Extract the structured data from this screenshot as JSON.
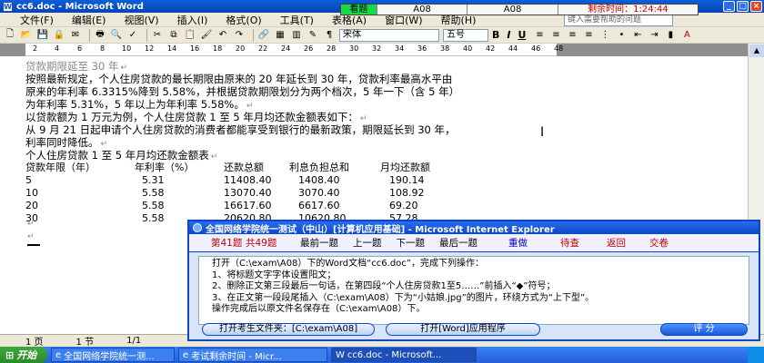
{
  "window": {
    "title": "cc6.doc - Microsoft Word"
  },
  "menu": {
    "items": [
      "文件(F)",
      "编辑(E)",
      "视图(V)",
      "插入(I)",
      "格式(O)",
      "工具(T)",
      "表格(A)",
      "窗口(W)",
      "帮助(H)"
    ],
    "help_placeholder": "键入需要帮助的问题"
  },
  "exam_bar": {
    "view_label": "看题",
    "exam_id_1": "A08",
    "exam_id_2": "A08",
    "time_left": "剩余时间：1:24:44"
  },
  "toolbar": {
    "font_name": "宋体",
    "font_size": "五号",
    "bold": "B",
    "italic": "I",
    "underline": "U"
  },
  "ruler": {
    "ticks": [
      "2",
      "4",
      "6",
      "8",
      "10",
      "12",
      "14",
      "16",
      "18",
      "20",
      "22",
      "24",
      "26",
      "28",
      "30",
      "32",
      "34",
      "36",
      "38",
      "40",
      "42",
      "44",
      "46",
      "48"
    ]
  },
  "document": {
    "lines": [
      "贷款期限延至 30 年",
      "按照最新规定，个人住房贷款的最长期限由原来的 20 年延长到 30 年，贷款利率最高水平由",
      "原来的年利率 6.3315%降到 5.58%，并根据贷款期限划分为两个档次，5 年一下（含 5 年）",
      "为年利率 5.31%，5 年以上为年利率 5.58%。",
      "以贷款额为 1 万元为例，个人住房贷款 1 至 5 年月均还款金额表如下：",
      "从 9 月 21 日起申请个人住房贷款的消费者都能享受到银行的最新政策，期限延长到 30 年，",
      "利率同时降低。",
      "个人住房贷款 1 至 5 年月均还款金额表"
    ],
    "table": {
      "headers": [
        "贷款年限（年）",
        "年利率（%）",
        "还款总额",
        "利息负担总和",
        "月均还款额"
      ],
      "rows": [
        [
          "5",
          "5.31",
          "11408.40",
          "1408.40",
          "190.14"
        ],
        [
          "10",
          "5.58",
          "13070.40",
          "3070.40",
          "108.92"
        ],
        [
          "20",
          "5.58",
          "16617.60",
          "6617.60",
          "69.20"
        ],
        [
          "30",
          "5.58",
          "20620.80",
          "10620.80",
          "57.28"
        ]
      ]
    }
  },
  "statusbar": {
    "page": "1 页",
    "section": "1 节",
    "pages": "1/1"
  },
  "dialog": {
    "title": "全国网络学院统一测试（中山）[计算机应用基础] - Microsoft Internet Explorer",
    "nav": {
      "question_no": "第41题",
      "total": "共49题",
      "first": "最前一题",
      "prev": "上一题",
      "next": "下一题",
      "last": "最后一题",
      "redo": "重做",
      "pending": "待查",
      "back": "返回",
      "submit": "交卷"
    },
    "instructions": [
      "打开（C:\\exam\\A08）下的Word文档“cc6.doc”，完成下列操作：",
      "1、将标题文字字体设置阳文；",
      "2、删除正文第三段最后一句话，在第四段“个人住房贷款1至5……”前插入“◆”符号；",
      "3、在正文第一段段尾插入（C:\\exam\\A08）下为“小姑娘.jpg”的图片，环绕方式为“上下型”。",
      "操作完成后以原文件名保存在（C:\\exam\\A08）下。"
    ],
    "open_folder": "打开考生文件夹：[C:\\exam\\A08]",
    "open_word": "打开[Word]应用程序",
    "score": "评  分"
  },
  "taskbar": {
    "start": "开始",
    "items": [
      "全国网络学院统一测...",
      "考试剩余时间 - Micr...",
      "cc6.doc - Microsoft..."
    ]
  }
}
